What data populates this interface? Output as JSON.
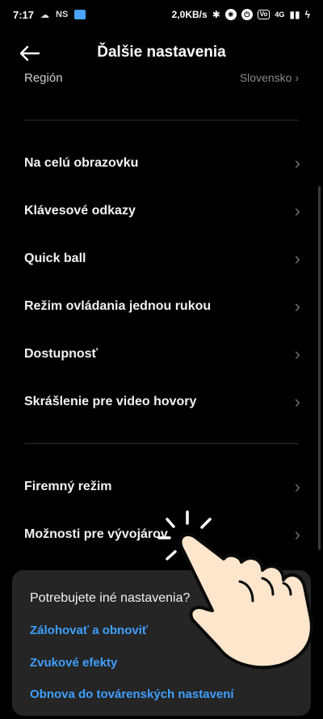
{
  "status_bar": {
    "time": "7:17",
    "ns_label": "NS",
    "speed": "2,0KB/s",
    "volte": "Vo",
    "signal": "4G"
  },
  "header": {
    "title": "Ďalšie nastavenia"
  },
  "region": {
    "label": "Región",
    "value": "Slovensko"
  },
  "items": [
    {
      "label": "Na celú obrazovku"
    },
    {
      "label": "Klávesové odkazy"
    },
    {
      "label": "Quick ball"
    },
    {
      "label": "Režim ovládania jednou rukou"
    },
    {
      "label": "Dostupnosť"
    },
    {
      "label": "Skrášlenie pre video hovory"
    },
    {
      "label": "Firemný režim"
    },
    {
      "label": "Možnosti pre vývojárov"
    }
  ],
  "sheet": {
    "question": "Potrebujete iné nastavenia?",
    "links": [
      {
        "label": "Zálohovať a obnoviť"
      },
      {
        "label": "Zvukové efekty"
      },
      {
        "label": "Obnova do továrenských nastavení"
      }
    ]
  }
}
